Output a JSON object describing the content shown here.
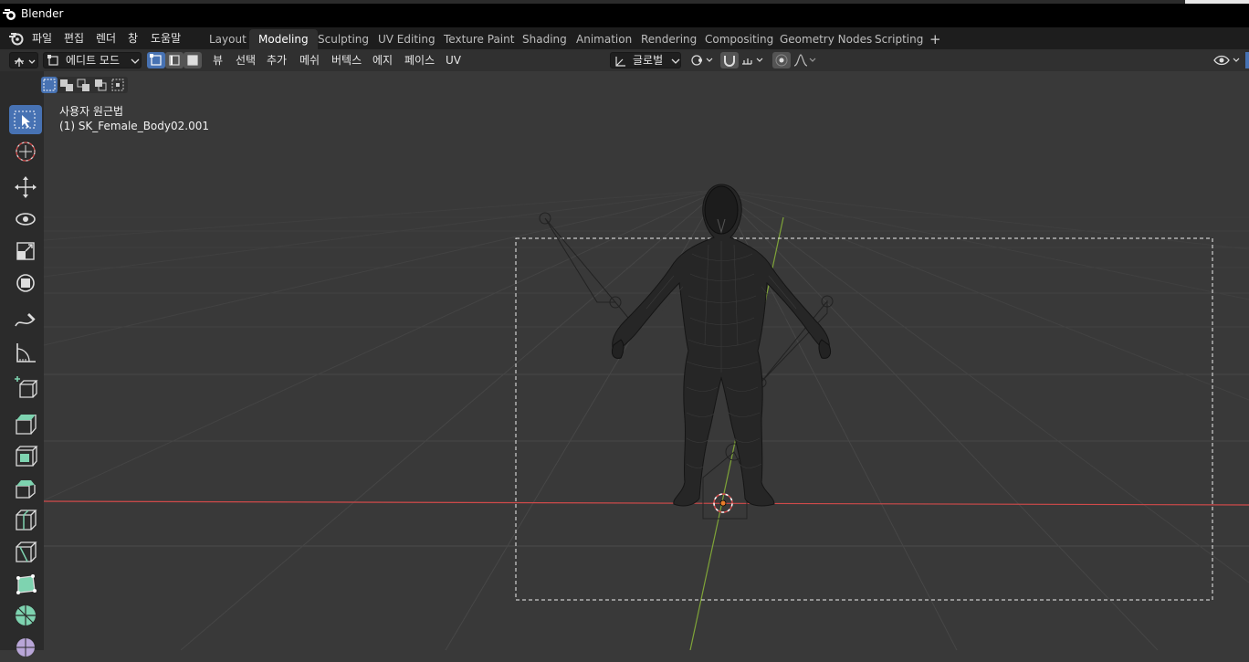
{
  "app": {
    "title": "Blender"
  },
  "menubar": {
    "items": [
      "파일",
      "편집",
      "렌더",
      "창",
      "도움말"
    ]
  },
  "workspace_tabs": [
    {
      "label": "Layout",
      "active": false
    },
    {
      "label": "Modeling",
      "active": true
    },
    {
      "label": "Sculpting",
      "active": false
    },
    {
      "label": "UV Editing",
      "active": false
    },
    {
      "label": "Texture Paint",
      "active": false
    },
    {
      "label": "Shading",
      "active": false
    },
    {
      "label": "Animation",
      "active": false
    },
    {
      "label": "Rendering",
      "active": false
    },
    {
      "label": "Compositing",
      "active": false
    },
    {
      "label": "Geometry Nodes",
      "active": false
    },
    {
      "label": "Scripting",
      "active": false
    }
  ],
  "add_workspace": "+",
  "header": {
    "mode": "에디트 모드",
    "menus": [
      "뷰",
      "선택",
      "추가",
      "메쉬",
      "버텍스",
      "에지",
      "페이스",
      "UV"
    ],
    "transform_orientation": "글로벌"
  },
  "viewport": {
    "view_name": "사용자 원근법",
    "object_name": "(1) SK_Female_Body02.001"
  },
  "colors": {
    "accent": "#4772b3",
    "x_axis": "#d04a4a",
    "y_axis": "#7fa438",
    "cursor": "#e87d2a",
    "tool_add": "#7ed3b0"
  },
  "icons": {
    "tools": [
      "select-box-icon",
      "cursor-icon",
      "move-icon",
      "rotate-icon",
      "scale-icon",
      "transform-icon",
      "annotate-icon",
      "measure-icon",
      "add-cube-icon",
      "extrude-icon",
      "inset-icon",
      "bevel-icon",
      "loop-cut-icon",
      "knife-icon",
      "poly-build-icon",
      "spin-icon",
      "smooth-icon"
    ]
  }
}
